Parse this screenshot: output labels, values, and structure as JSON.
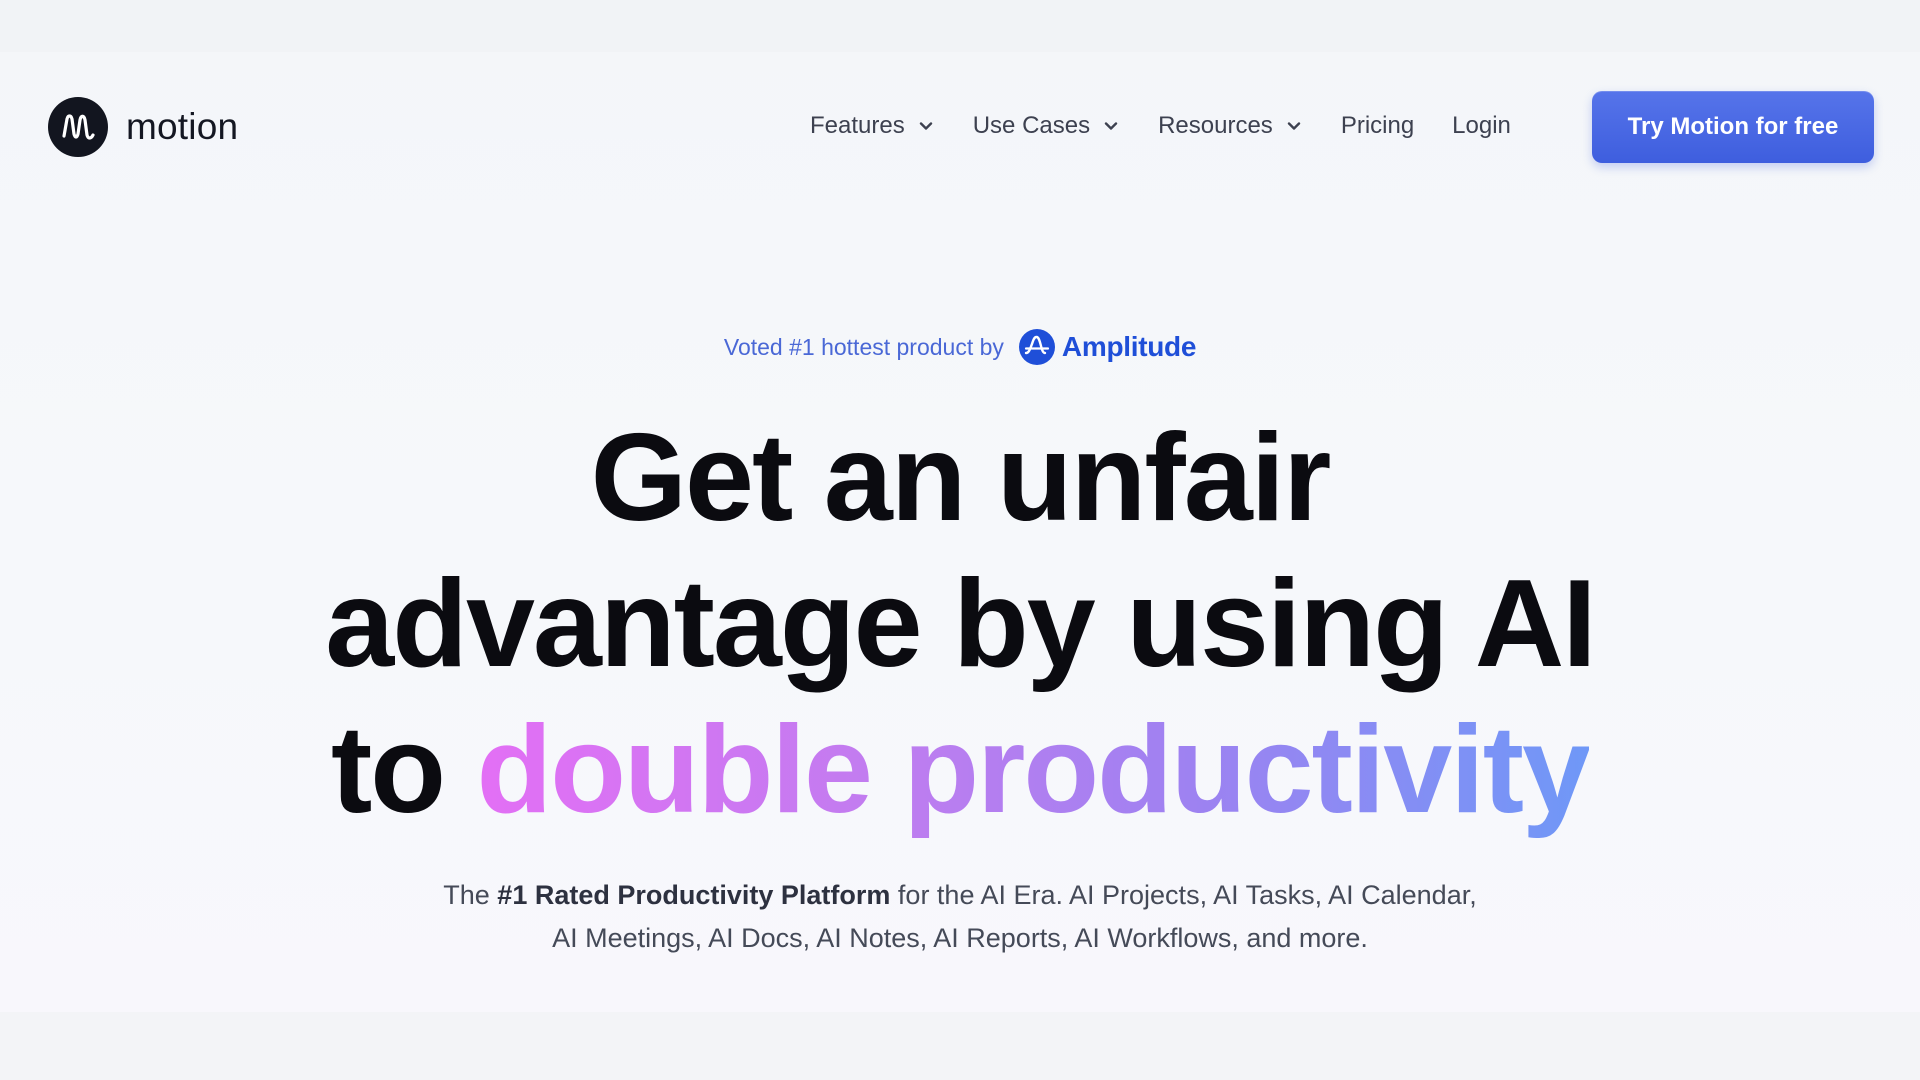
{
  "nav": {
    "logo_text": "motion",
    "items": [
      {
        "label": "Features",
        "has_dropdown": true
      },
      {
        "label": "Use Cases",
        "has_dropdown": true
      },
      {
        "label": "Resources",
        "has_dropdown": true
      },
      {
        "label": "Pricing",
        "has_dropdown": false
      },
      {
        "label": "Login",
        "has_dropdown": false
      }
    ],
    "cta_label": "Try Motion for free"
  },
  "hero": {
    "badge": {
      "text": "Voted #1 hottest product by",
      "brand": "Amplitude"
    },
    "headline": {
      "line1": "Get an unfair",
      "line2": "advantage by using AI",
      "line3_plain": "to",
      "line3_gradient": "double productivity"
    },
    "subtitle": {
      "prefix": "The",
      "bold": "#1 Rated Productivity Platform",
      "suffix": "for the AI Era. AI Projects, AI Tasks, AI Calendar, AI Meetings, AI Docs, AI Notes, AI Reports, AI Workflows, and more."
    }
  },
  "colors": {
    "cta_bg": "#4463e0",
    "badge_text": "#4a68d6",
    "amplitude_brand": "#1f4fd8",
    "gradient_start": "#e36ff5",
    "gradient_end": "#6f98f7",
    "headline": "#0b0b10"
  },
  "icons": {
    "logo": "motion-logo-icon",
    "dropdown": "chevron-down-icon",
    "amplitude": "amplitude-logo-icon"
  }
}
